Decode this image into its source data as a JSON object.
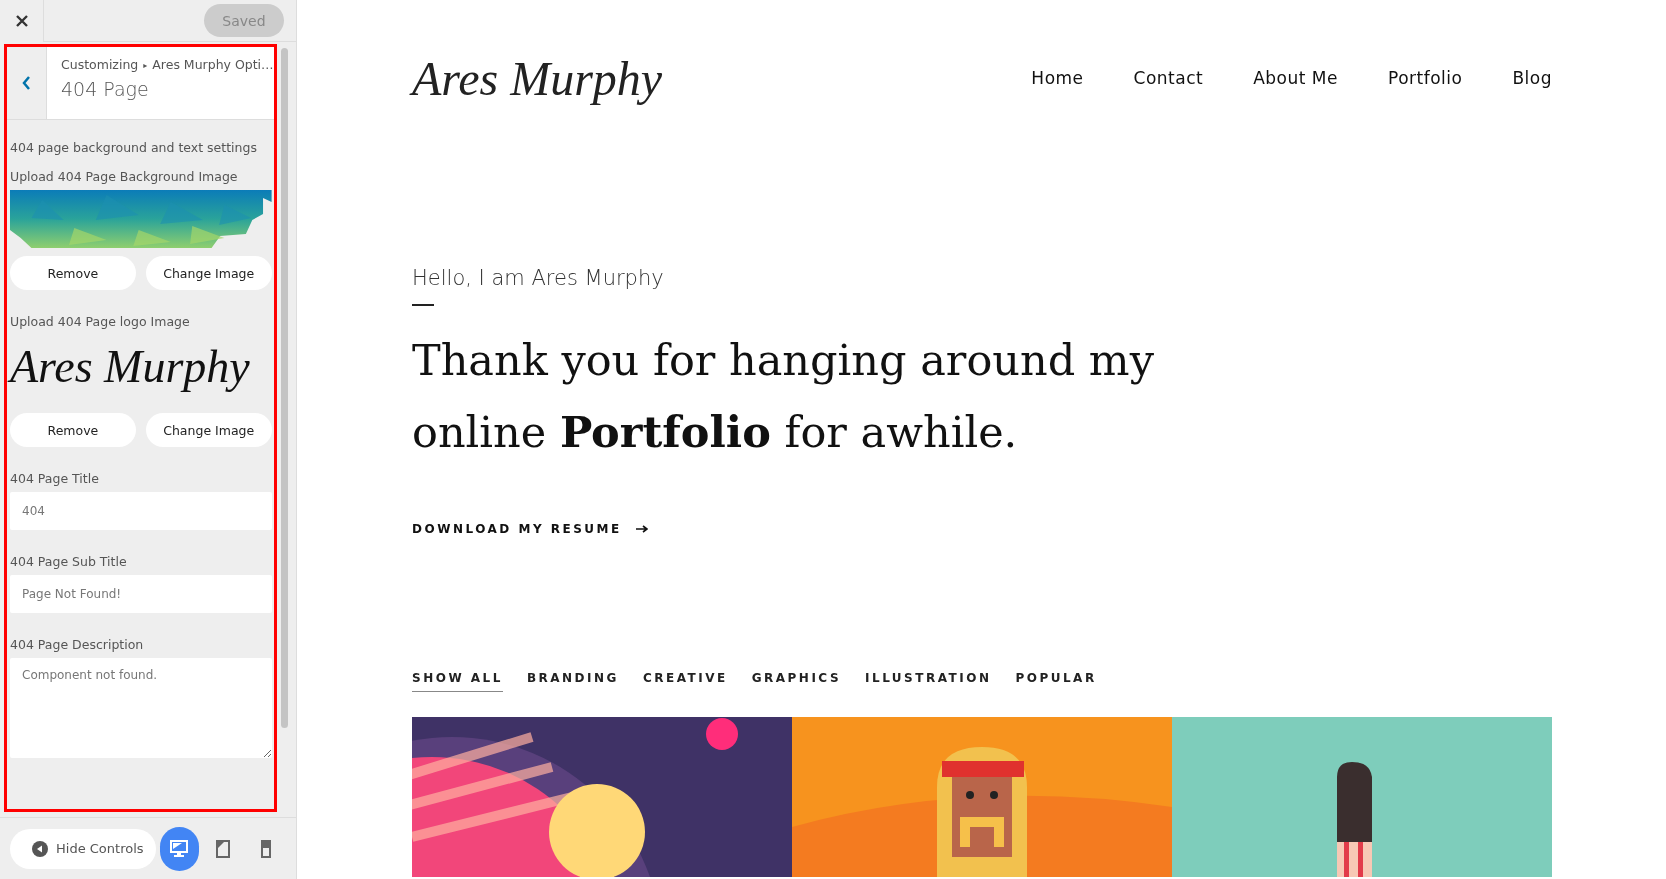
{
  "sidebar": {
    "save_button": {
      "label": "Saved",
      "disabled": true
    },
    "breadcrumb": {
      "parent": "Customizing",
      "separator": "▸",
      "section": "Ares Murphy Opti…"
    },
    "title": "404 Page",
    "description": "404 page background and text settings",
    "controls": [
      {
        "kind": "background_image",
        "label": "Upload 404 Page Background Image",
        "buttons": [
          "Remove",
          "Change Image"
        ]
      },
      {
        "kind": "logo_image",
        "label": "Upload 404 Page logo Image",
        "logo_text": "Ares Murphy",
        "buttons": [
          "Remove",
          "Change Image"
        ]
      },
      {
        "kind": "text",
        "label": "404 Page Title",
        "value": "404"
      },
      {
        "kind": "text",
        "label": "404 Page Sub Title",
        "value": "Page Not Found!"
      },
      {
        "kind": "textarea",
        "label": "404 Page Description",
        "value": "Component not found."
      }
    ],
    "footer": {
      "hide_button": "Hide Controls",
      "devices": [
        {
          "kind": "desktop",
          "selected": true
        },
        {
          "kind": "tablet",
          "selected": false
        },
        {
          "kind": "mobile",
          "selected": false
        }
      ]
    }
  },
  "preview": {
    "logo": "Ares Murphy",
    "nav": [
      "Home",
      "Contact",
      "About Me",
      "Portfolio",
      "Blog"
    ],
    "intro": "Hello, I am Ares Murphy",
    "heading": [
      "Thank you for hanging around my",
      "online **Portfolio** for awhile."
    ],
    "cta": "DOWNLOAD MY RESUME",
    "filters": [
      {
        "label": "SHOW ALL",
        "selected": true
      },
      {
        "label": "BRANDING",
        "selected": false
      },
      {
        "label": "CREATIVE",
        "selected": false
      },
      {
        "label": "GRAPHICS",
        "selected": false
      },
      {
        "label": "ILLUSTRATION",
        "selected": false
      },
      {
        "label": "POPULAR",
        "selected": false
      }
    ],
    "portfolio": [
      {
        "kind": "planet"
      },
      {
        "kind": "wrestler"
      },
      {
        "kind": "popsicle"
      }
    ]
  }
}
